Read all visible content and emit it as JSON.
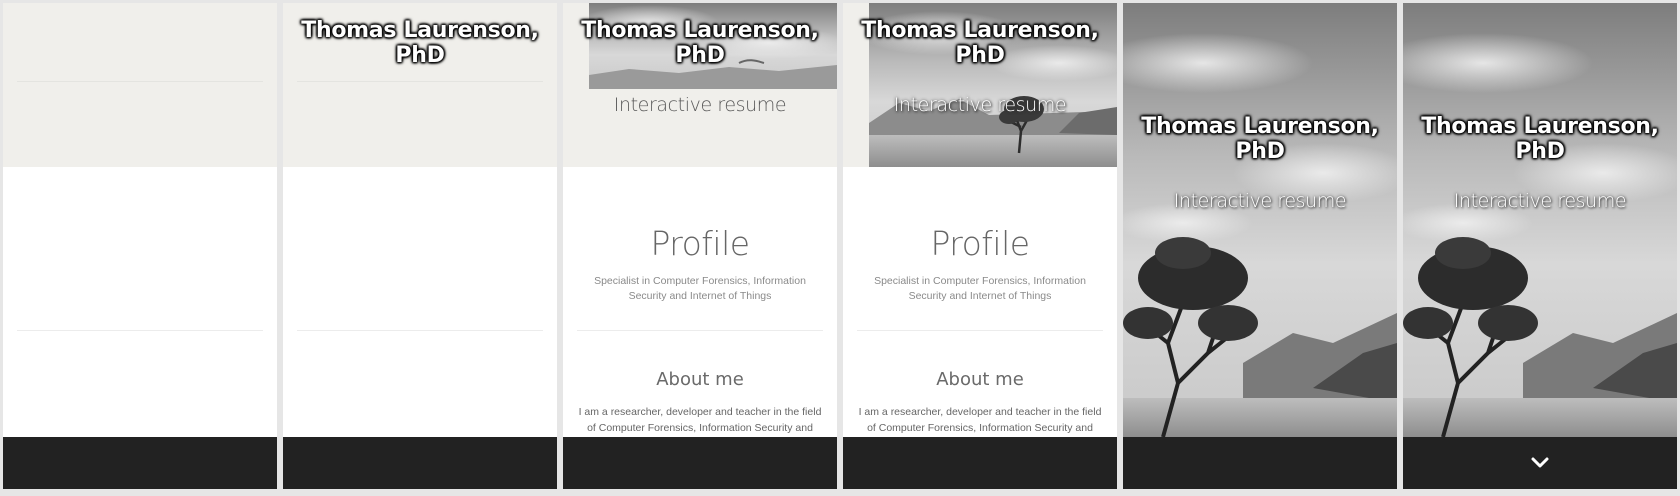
{
  "hero": {
    "name": "Thomas Laurenson, PhD",
    "subtitle": "Interactive resume"
  },
  "profile": {
    "title": "Profile",
    "text": "Specialist in Computer Forensics, Information Security and Internet of Things"
  },
  "about": {
    "title": "About me",
    "text": "I am a researcher, developer and teacher in the field of Computer Forensics, Information Security and Internet"
  },
  "icons": {
    "scroll_down": "chevron-down-icon"
  },
  "colors": {
    "header_bg": "#f0efeb",
    "footer_bg": "#222222",
    "page_bg": "#ffffff"
  }
}
